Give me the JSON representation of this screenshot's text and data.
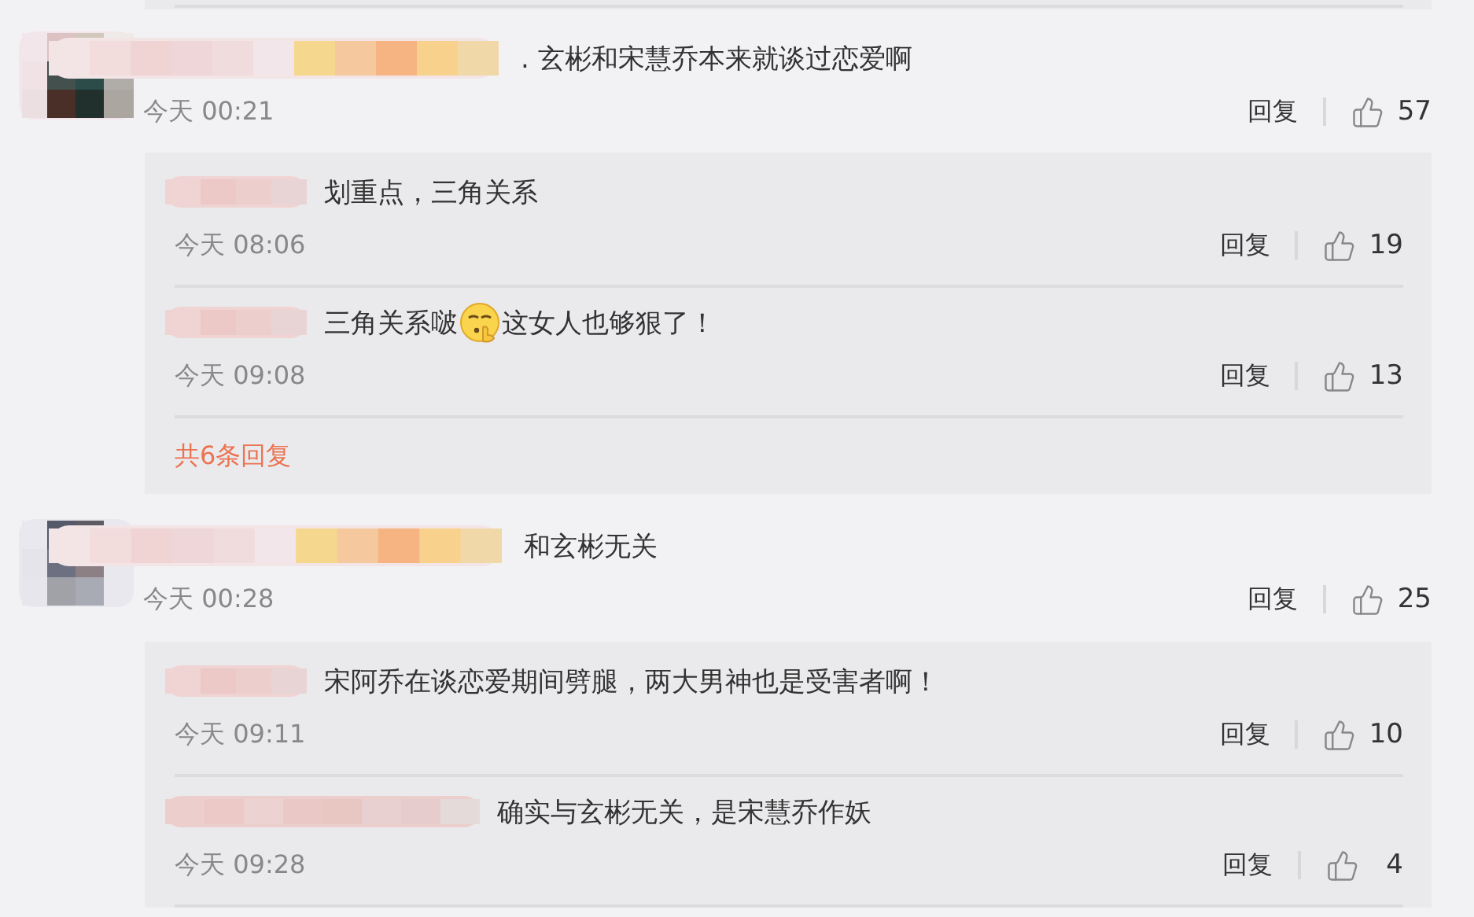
{
  "threads": [
    {
      "comment": {
        "parts": [
          {
            "kind": "text",
            "text": ". 玄彬和宋慧乔本来就谈过恋爱啊"
          }
        ],
        "time": "今天 00:21",
        "reply_label": "回复",
        "likes": "57"
      },
      "replies": [
        {
          "parts": [
            {
              "kind": "text",
              "text": "划重点，三角关系"
            }
          ],
          "time": "今天 08:06",
          "reply_label": "回复",
          "likes": "19"
        },
        {
          "parts": [
            {
              "kind": "text",
              "text": "三角关系啵"
            },
            {
              "kind": "emoji"
            },
            {
              "kind": "text",
              "text": "这女人也够狠了！"
            }
          ],
          "time": "今天 09:08",
          "reply_label": "回复",
          "likes": "13"
        }
      ],
      "more_link": "共6条回复"
    },
    {
      "comment": {
        "parts": [
          {
            "kind": "text",
            "text": "和玄彬无关"
          }
        ],
        "time": "今天 00:28",
        "reply_label": "回复",
        "likes": "25"
      },
      "replies": [
        {
          "parts": [
            {
              "kind": "text",
              "text": "宋阿乔在谈恋爱期间劈腿，两大男神也是受害者啊！"
            }
          ],
          "time": "今天 09:11",
          "reply_label": "回复",
          "likes": "10"
        },
        {
          "parts": [
            {
              "kind": "text",
              "text": "确实与玄彬无关，是宋慧乔作妖"
            }
          ],
          "time": "今天 09:28",
          "reply_label": "回复",
          "likes": "4"
        }
      ]
    }
  ]
}
